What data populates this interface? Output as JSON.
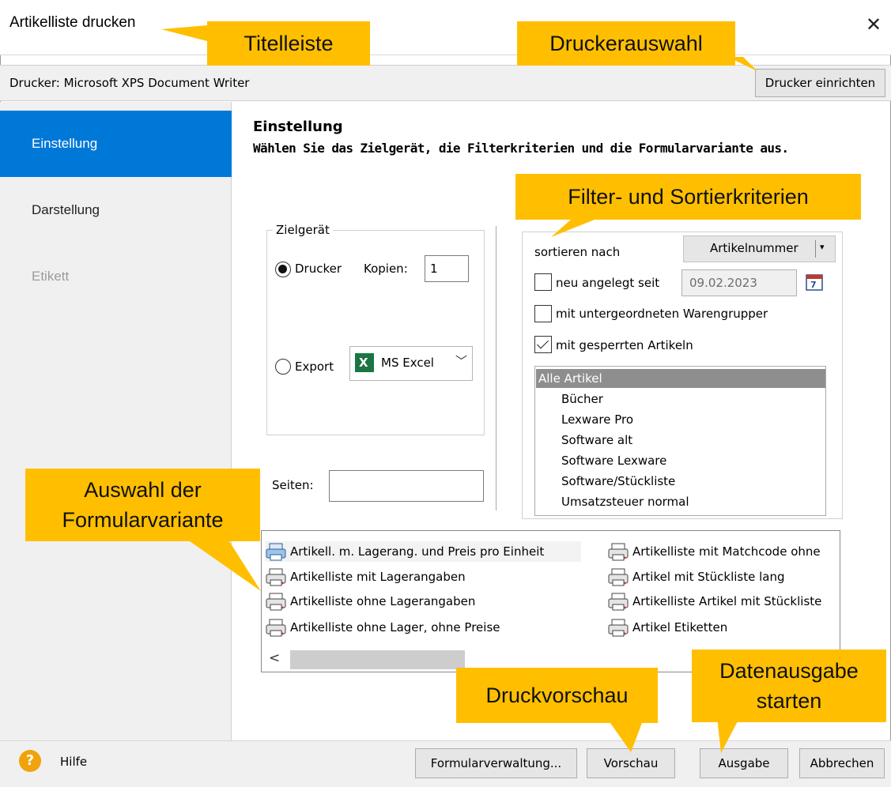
{
  "window": {
    "title": "Artikelliste drucken",
    "close_glyph": "✕"
  },
  "printer": {
    "label": "Drucker:  Microsoft XPS Document Writer",
    "setup_button": "Drucker einrichten"
  },
  "sidebar": {
    "items": [
      {
        "label": "Einstellung",
        "state": "selected"
      },
      {
        "label": "Darstellung",
        "state": "normal"
      },
      {
        "label": "Etikett",
        "state": "disabled"
      }
    ]
  },
  "main": {
    "heading": "Einstellung",
    "subheading": "Wählen Sie das Zielgerät, die Filterkriterien und die Formularvariante aus."
  },
  "zielgeraet": {
    "legend": "Zielgerät",
    "drucker_label": "Drucker",
    "drucker_selected": true,
    "kopien_label": "Kopien:",
    "kopien_value": "1",
    "export_label": "Export",
    "export_selected": false,
    "export_format": "MS Excel",
    "seiten_label": "Seiten:",
    "seiten_value": ""
  },
  "filter": {
    "sort_label": "sortieren nach",
    "sort_value": "Artikelnummer",
    "neu_label": "neu angelegt seit",
    "neu_checked": false,
    "date_value": "09.02.2023",
    "waren_label": "mit untergeordneten Warengrupper",
    "waren_checked": false,
    "gesperrt_label": "mit gesperrten Artikeln",
    "gesperrt_checked": true,
    "groups": [
      {
        "label": "Alle Artikel",
        "selected": true
      },
      {
        "label": "Bücher",
        "selected": false
      },
      {
        "label": "Lexware Pro",
        "selected": false
      },
      {
        "label": "Software alt",
        "selected": false
      },
      {
        "label": "Software Lexware",
        "selected": false
      },
      {
        "label": "Software/Stückliste",
        "selected": false
      },
      {
        "label": "Umsatzsteuer normal",
        "selected": false
      }
    ]
  },
  "forms": {
    "items": [
      {
        "label": "Artikell. m. Lagerang. und Preis pro Einheit",
        "selected": true
      },
      {
        "label": "Artikelliste mit Lagerangaben",
        "selected": false
      },
      {
        "label": "Artikelliste ohne Lagerangaben",
        "selected": false
      },
      {
        "label": "Artikelliste ohne Lager, ohne Preise",
        "selected": false
      },
      {
        "label": "Artikelliste mit Matchcode ohne",
        "selected": false
      },
      {
        "label": "Artikel mit Stückliste lang",
        "selected": false
      },
      {
        "label": "Artikelliste Artikel mit Stückliste",
        "selected": false
      },
      {
        "label": "Artikel Etiketten",
        "selected": false
      }
    ],
    "scroll_left_glyph": "<"
  },
  "footer": {
    "help_glyph": "?",
    "help_label": "Hilfe",
    "formular_button": "Formularverwaltung...",
    "vorschau_button": "Vorschau",
    "ausgabe_button": "Ausgabe",
    "abbrechen_button": "Abbrechen"
  },
  "callouts": {
    "titelleiste": "Titelleiste",
    "druckerauswahl": "Druckerauswahl",
    "filter": "Filter- und Sortierkriterien",
    "formularvariante_line1": "Auswahl der",
    "formularvariante_line2": "Formularvariante",
    "druckvorschau": "Druckvorschau",
    "datenausgabe_line1": "Datenausgabe",
    "datenausgabe_line2": "starten"
  },
  "colors": {
    "accent": "#0078d7",
    "callout": "#ffbf00",
    "help_icon": "#f0a30a",
    "excel": "#1f7244"
  }
}
